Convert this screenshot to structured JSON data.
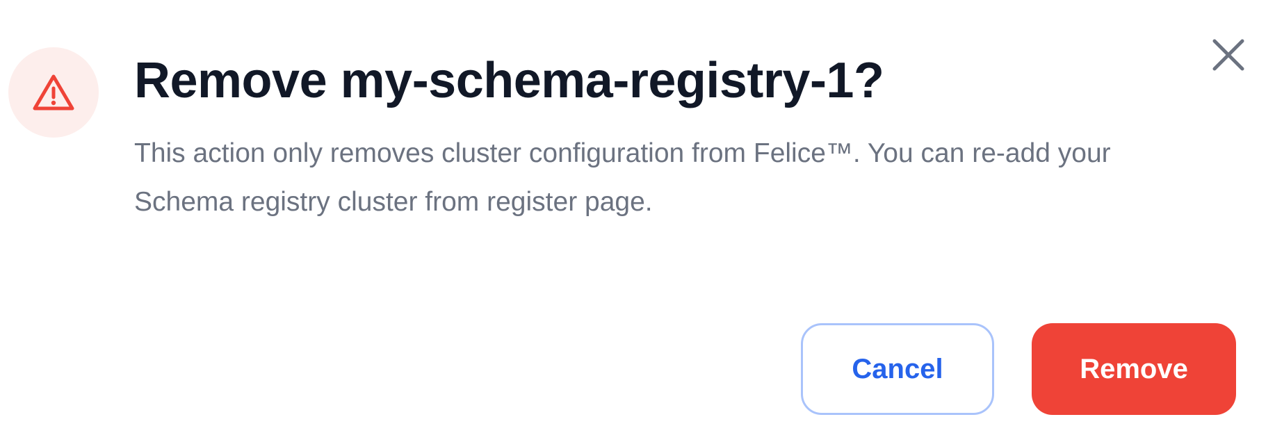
{
  "dialog": {
    "title": "Remove my-schema-registry-1?",
    "description": "This action only removes cluster configuration from Felice™. You can re-add your Schema registry cluster from register page.",
    "icons": {
      "badge": "warning-triangle-icon",
      "close": "close-icon"
    },
    "buttons": {
      "cancel_label": "Cancel",
      "remove_label": "Remove"
    },
    "colors": {
      "danger": "#ef4337",
      "danger_tint": "#fdeeec",
      "primary": "#2663eb",
      "primary_border": "#a9c3fb",
      "title": "#111827",
      "body": "#6b7280",
      "close_icon": "#6b7280"
    }
  }
}
